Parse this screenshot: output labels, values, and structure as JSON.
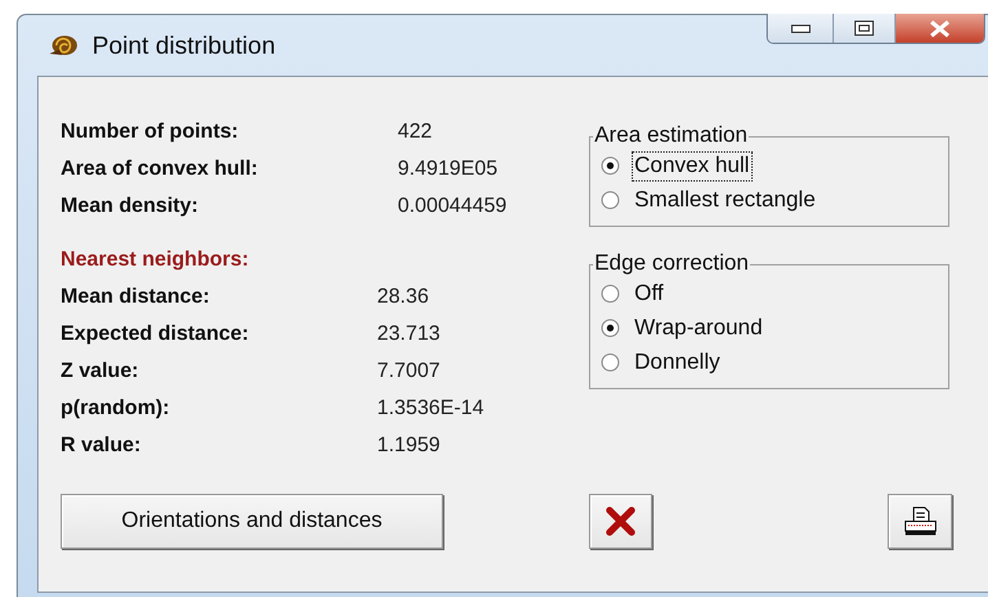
{
  "window": {
    "title": "Point distribution"
  },
  "summary": [
    {
      "label": "Number of points:",
      "value": "422"
    },
    {
      "label": "Area of convex hull:",
      "value": "9.4919E05"
    },
    {
      "label": "Mean density:",
      "value": "0.00044459"
    }
  ],
  "nearest_neighbors": {
    "heading": "Nearest neighbors:",
    "rows": [
      {
        "label": "Mean distance:",
        "value": "28.36"
      },
      {
        "label": "Expected distance:",
        "value": "23.713"
      },
      {
        "label": "Z value:",
        "value": "7.7007"
      },
      {
        "label": "p(random):",
        "value": "1.3536E-14"
      },
      {
        "label": "R value:",
        "value": "1.1959"
      }
    ]
  },
  "groups": [
    {
      "title": "Area estimation",
      "options": [
        {
          "label": "Convex hull",
          "selected": true,
          "focused": true
        },
        {
          "label": "Smallest rectangle",
          "selected": false,
          "focused": false
        }
      ]
    },
    {
      "title": "Edge correction",
      "options": [
        {
          "label": "Off",
          "selected": false,
          "focused": false
        },
        {
          "label": "Wrap-around",
          "selected": true,
          "focused": false
        },
        {
          "label": "Donnelly",
          "selected": false,
          "focused": false
        }
      ]
    }
  ],
  "buttons": [
    {
      "kind": "text",
      "label": "Orientations and distances"
    },
    {
      "kind": "close"
    },
    {
      "kind": "print"
    }
  ]
}
